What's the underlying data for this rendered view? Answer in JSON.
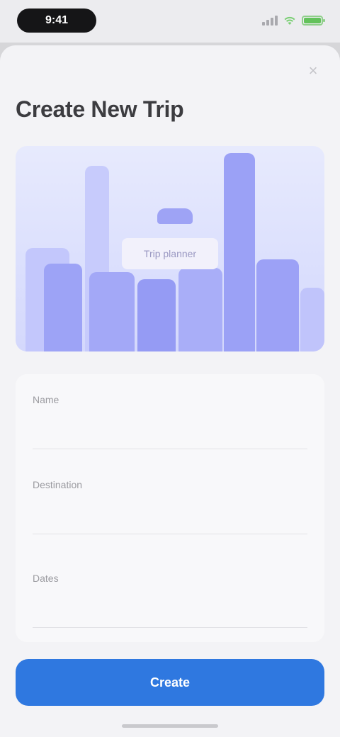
{
  "status_bar": {
    "time": "9:41",
    "signal_icon": "signal-icon",
    "wifi_icon": "wifi-icon",
    "battery_icon": "battery-icon"
  },
  "sheet": {
    "close_icon": "close-icon",
    "close_glyph": "×",
    "title": "Create New Trip"
  },
  "illustration": {
    "label": "Trip planner",
    "colors": {
      "background": "#e7eafd",
      "bar_light": "#b6bbfb",
      "bar_dark": "#8f95f3"
    }
  },
  "form": {
    "fields": [
      {
        "label": "Name",
        "placeholder": "",
        "value": ""
      },
      {
        "label": "Destination",
        "placeholder": "",
        "value": ""
      },
      {
        "label": "Dates",
        "placeholder": "",
        "value": ""
      }
    ]
  },
  "actions": {
    "primary_label": "Create",
    "primary_color": "#2f78e0"
  }
}
